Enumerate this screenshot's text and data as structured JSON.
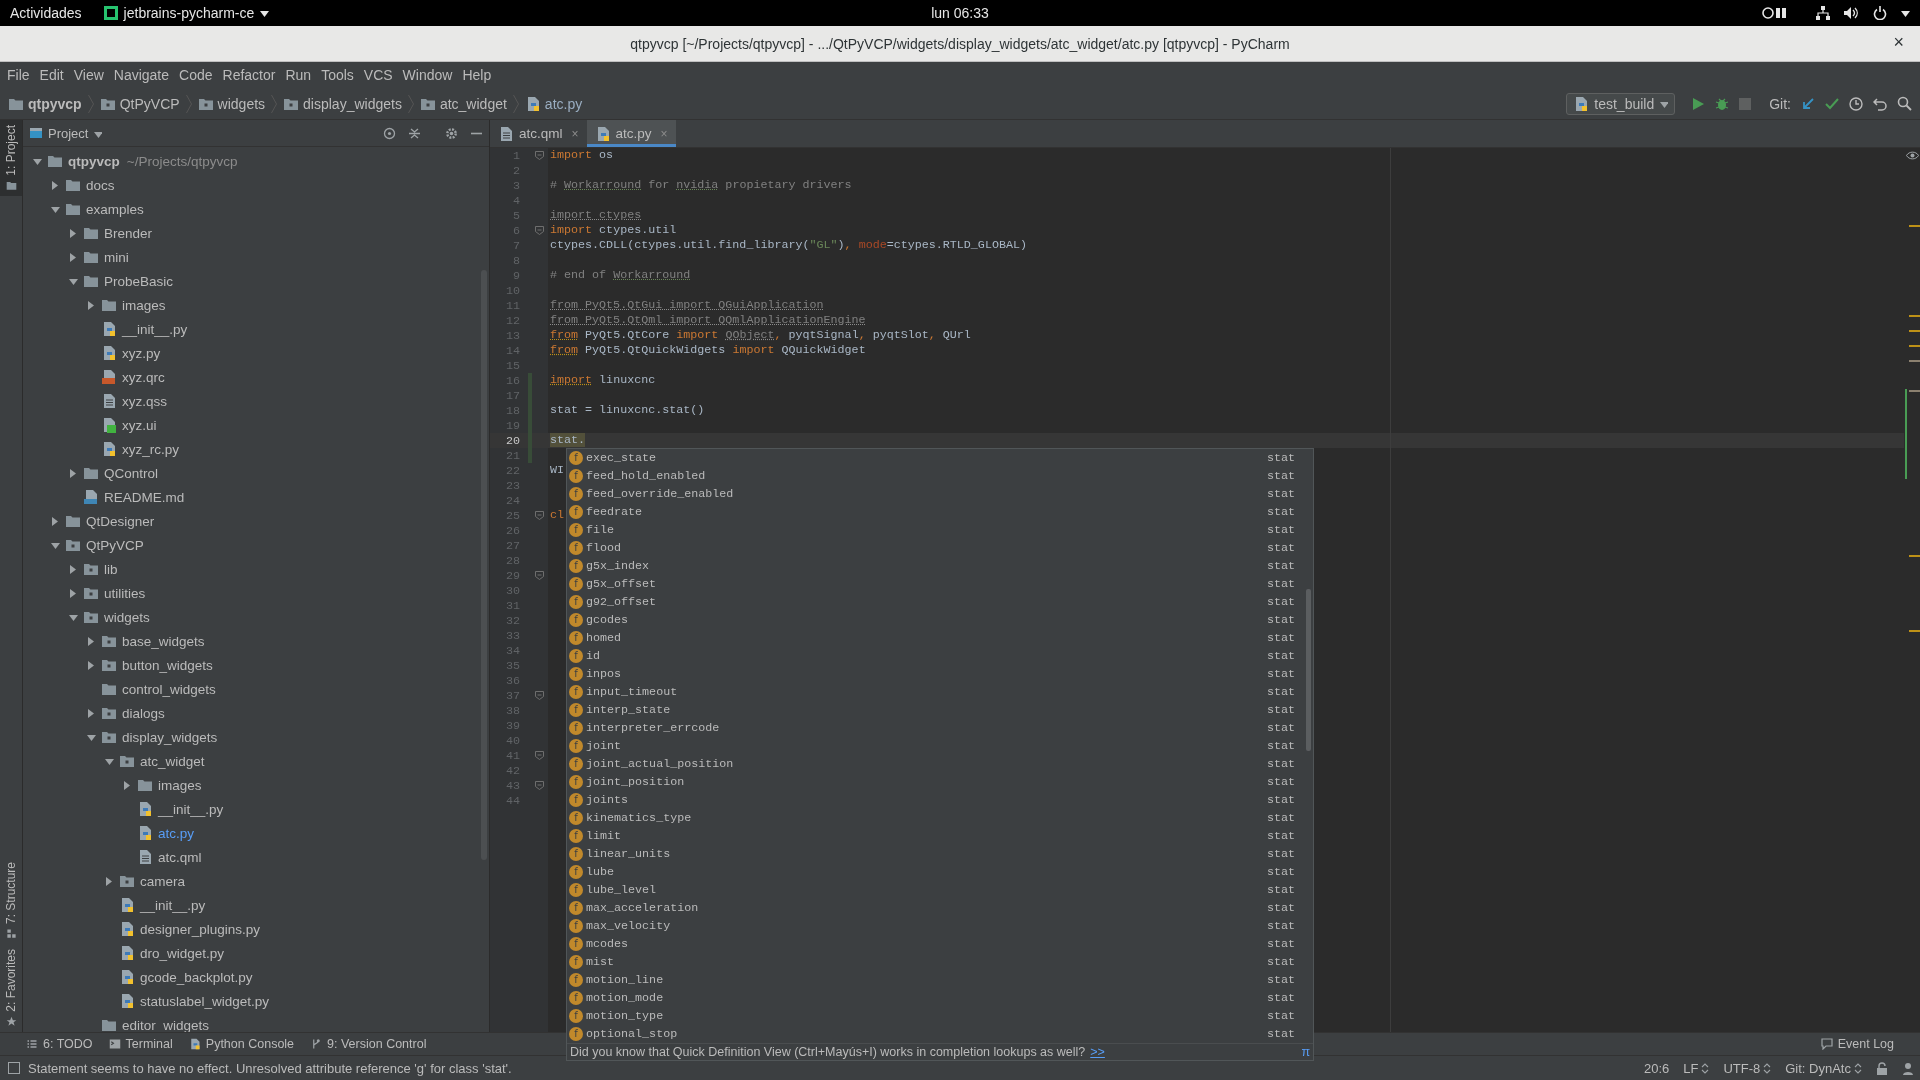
{
  "topbar": {
    "activities": "Actividades",
    "app": "jetbrains-pycharm-ce",
    "clock": "lun 06:33"
  },
  "window": {
    "title": "qtpyvcp [~/Projects/qtpyvcp] - .../QtPyVCP/widgets/display_widgets/atc_widget/atc.py [qtpyvcp] - PyCharm",
    "close": "×"
  },
  "menu": [
    "File",
    "Edit",
    "View",
    "Navigate",
    "Code",
    "Refactor",
    "Run",
    "Tools",
    "VCS",
    "Window",
    "Help"
  ],
  "breadcrumbs": [
    {
      "label": "qtpyvcp",
      "kind": "folder"
    },
    {
      "label": "QtPyVCP",
      "kind": "package"
    },
    {
      "label": "widgets",
      "kind": "package"
    },
    {
      "label": "display_widgets",
      "kind": "package"
    },
    {
      "label": "atc_widget",
      "kind": "package"
    },
    {
      "label": "atc.py",
      "kind": "python"
    }
  ],
  "toolbar": {
    "run_config": "test_build",
    "git_label": "Git:"
  },
  "tool_stripe": [
    {
      "label": "1: Project",
      "kind": "project",
      "selected": true
    },
    {
      "label": "7: Structure",
      "kind": "structure",
      "selected": false
    },
    {
      "label": "2: Favorites",
      "kind": "favorites",
      "selected": false
    }
  ],
  "project": {
    "title": "Project",
    "tree": [
      {
        "label": "qtpyvcp",
        "path": "~/Projects/qtpyvcp",
        "kind": "folder",
        "expanded": true,
        "selected": false,
        "children": [
          {
            "label": "docs",
            "kind": "folder",
            "expanded": false,
            "selected": false
          },
          {
            "label": "examples",
            "kind": "folder",
            "expanded": true,
            "selected": false,
            "children": [
              {
                "label": "Brender",
                "kind": "folder",
                "expanded": false,
                "selected": false
              },
              {
                "label": "mini",
                "kind": "folder",
                "expanded": false,
                "selected": false
              },
              {
                "label": "ProbeBasic",
                "kind": "folder",
                "expanded": true,
                "selected": false,
                "children": [
                  {
                    "label": "images",
                    "kind": "folder",
                    "expanded": false,
                    "selected": false
                  },
                  {
                    "label": "__init__.py",
                    "kind": "python",
                    "selected": false
                  },
                  {
                    "label": "xyz.py",
                    "kind": "python",
                    "selected": false
                  },
                  {
                    "label": "xyz.qrc",
                    "kind": "qrc",
                    "selected": false
                  },
                  {
                    "label": "xyz.qss",
                    "kind": "text",
                    "selected": false
                  },
                  {
                    "label": "xyz.ui",
                    "kind": "ui",
                    "selected": false
                  },
                  {
                    "label": "xyz_rc.py",
                    "kind": "python",
                    "selected": false
                  }
                ]
              },
              {
                "label": "QControl",
                "kind": "folder",
                "expanded": false,
                "selected": false
              },
              {
                "label": "README.md",
                "kind": "md",
                "selected": false
              }
            ]
          },
          {
            "label": "QtDesigner",
            "kind": "folder",
            "expanded": false,
            "selected": false
          },
          {
            "label": "QtPyVCP",
            "kind": "package",
            "expanded": true,
            "selected": false,
            "children": [
              {
                "label": "lib",
                "kind": "package",
                "expanded": false,
                "selected": false
              },
              {
                "label": "utilities",
                "kind": "package",
                "expanded": false,
                "selected": false
              },
              {
                "label": "widgets",
                "kind": "package",
                "expanded": true,
                "selected": false,
                "children": [
                  {
                    "label": "base_widgets",
                    "kind": "package",
                    "expanded": false,
                    "selected": false
                  },
                  {
                    "label": "button_widgets",
                    "kind": "package",
                    "expanded": false,
                    "selected": false
                  },
                  {
                    "label": "control_widgets",
                    "kind": "folder",
                    "selected": false
                  },
                  {
                    "label": "dialogs",
                    "kind": "package",
                    "expanded": false,
                    "selected": false
                  },
                  {
                    "label": "display_widgets",
                    "kind": "package",
                    "expanded": true,
                    "selected": false,
                    "children": [
                      {
                        "label": "atc_widget",
                        "kind": "package",
                        "expanded": true,
                        "selected": false,
                        "children": [
                          {
                            "label": "images",
                            "kind": "folder",
                            "expanded": false,
                            "selected": false
                          },
                          {
                            "label": "__init__.py",
                            "kind": "python",
                            "selected": false
                          },
                          {
                            "label": "atc.py",
                            "kind": "python",
                            "selected": true
                          },
                          {
                            "label": "atc.qml",
                            "kind": "text",
                            "selected": false
                          }
                        ]
                      },
                      {
                        "label": "camera",
                        "kind": "package",
                        "expanded": false,
                        "selected": false
                      },
                      {
                        "label": "__init__.py",
                        "kind": "python",
                        "selected": false
                      },
                      {
                        "label": "designer_plugins.py",
                        "kind": "python",
                        "selected": false
                      },
                      {
                        "label": "dro_widget.py",
                        "kind": "python",
                        "selected": false
                      },
                      {
                        "label": "gcode_backplot.py",
                        "kind": "python",
                        "selected": false
                      },
                      {
                        "label": "statuslabel_widget.py",
                        "kind": "python",
                        "selected": false
                      }
                    ]
                  },
                  {
                    "label": "editor_widgets",
                    "kind": "folder",
                    "selected": false
                  }
                ]
              }
            ]
          }
        ]
      }
    ]
  },
  "tabs": [
    {
      "label": "atc.qml",
      "kind": "text",
      "selected": false,
      "close": "×"
    },
    {
      "label": "atc.py",
      "kind": "python",
      "selected": true,
      "close": "×"
    }
  ],
  "editor": {
    "lines": [
      {
        "number": "1",
        "fold": true,
        "changed": false,
        "current": false,
        "tokens": [
          {
            "kind": "kw",
            "text": "import"
          },
          {
            "kind": "text",
            "text": " os"
          }
        ]
      },
      {
        "number": "2",
        "fold": false,
        "changed": false,
        "current": false
      },
      {
        "number": "3",
        "fold": false,
        "changed": false,
        "current": false,
        "tokens": [
          {
            "kind": "comment",
            "text": "# "
          },
          {
            "kind": "typo",
            "text": "Workarround"
          },
          {
            "kind": "comment",
            "text": " for "
          },
          {
            "kind": "typo",
            "text": "nvidia"
          },
          {
            "kind": "comment",
            "text": " propietary"
          },
          {
            "kind": "comment",
            "text": " drivers"
          }
        ]
      },
      {
        "number": "4",
        "fold": false,
        "changed": false,
        "current": false
      },
      {
        "number": "5",
        "fold": false,
        "changed": false,
        "current": false,
        "tokens": [
          {
            "kind": "unused",
            "text": "import ctypes"
          }
        ]
      },
      {
        "number": "6",
        "fold": true,
        "changed": false,
        "current": false,
        "tokens": [
          {
            "kind": "kw",
            "text": "import"
          },
          {
            "kind": "text",
            "text": " ctypes.util"
          }
        ]
      },
      {
        "number": "7",
        "fold": false,
        "changed": false,
        "current": false,
        "tokens": [
          {
            "kind": "text",
            "text": "ctypes.CDLL(ctypes.util.find_library("
          },
          {
            "kind": "string",
            "text": "\"GL\""
          },
          {
            "kind": "text",
            "text": ")"
          },
          {
            "kind": "kw",
            "text": ", "
          },
          {
            "kind": "param",
            "text": "mode"
          },
          {
            "kind": "text",
            "text": "=ctypes.RTLD_GLOBAL)"
          }
        ]
      },
      {
        "number": "8",
        "fold": false,
        "changed": false,
        "current": false
      },
      {
        "number": "9",
        "fold": false,
        "changed": false,
        "current": false,
        "tokens": [
          {
            "kind": "comment",
            "text": "# end of "
          },
          {
            "kind": "typo",
            "text": "Workarround"
          }
        ]
      },
      {
        "number": "10",
        "fold": false,
        "changed": false,
        "current": false
      },
      {
        "number": "11",
        "fold": false,
        "changed": false,
        "current": false,
        "tokens": [
          {
            "kind": "unused",
            "text": "from PyQt5.QtGui import QGuiApplication"
          }
        ]
      },
      {
        "number": "12",
        "fold": false,
        "changed": false,
        "current": false,
        "tokens": [
          {
            "kind": "unused",
            "text": "from PyQt5.QtQml import QQmlApplicationEngine"
          }
        ]
      },
      {
        "number": "13",
        "fold": false,
        "changed": false,
        "current": false,
        "tokens": [
          {
            "kind": "kwwarn",
            "text": "from"
          },
          {
            "kind": "text",
            "text": " PyQt5.QtCore "
          },
          {
            "kind": "kw",
            "text": "import "
          },
          {
            "kind": "unused",
            "text": "QObject"
          },
          {
            "kind": "kw",
            "text": ", "
          },
          {
            "kind": "text",
            "text": "pyqtSignal"
          },
          {
            "kind": "kw",
            "text": ", "
          },
          {
            "kind": "text",
            "text": "pyqtSlot"
          },
          {
            "kind": "kw",
            "text": ", "
          },
          {
            "kind": "text",
            "text": "QUrl"
          }
        ]
      },
      {
        "number": "14",
        "fold": false,
        "changed": false,
        "current": false,
        "tokens": [
          {
            "kind": "kwwarn",
            "text": "from"
          },
          {
            "kind": "text",
            "text": " PyQt5.QtQuickWidgets "
          },
          {
            "kind": "kw",
            "text": "import"
          },
          {
            "kind": "text",
            "text": " QQuickWidget"
          }
        ]
      },
      {
        "number": "15",
        "fold": false,
        "changed": false,
        "current": false
      },
      {
        "number": "16",
        "fold": false,
        "changed": true,
        "current": false,
        "tokens": [
          {
            "kind": "kwwarn",
            "text": "import"
          },
          {
            "kind": "text",
            "text": " linuxcnc"
          }
        ]
      },
      {
        "number": "17",
        "fold": false,
        "changed": true,
        "current": false
      },
      {
        "number": "18",
        "fold": false,
        "changed": true,
        "current": false,
        "tokens": [
          {
            "kind": "text",
            "text": "stat = linuxcnc.stat()"
          }
        ]
      },
      {
        "number": "19",
        "fold": false,
        "changed": true,
        "current": false
      },
      {
        "number": "20",
        "fold": false,
        "changed": true,
        "current": true,
        "tokens": [
          {
            "kind": "warn",
            "text": "stat."
          }
        ]
      },
      {
        "number": "21",
        "fold": false,
        "changed": true,
        "current": false
      },
      {
        "number": "22",
        "fold": false,
        "changed": false,
        "current": false,
        "tokens": [
          {
            "kind": "text",
            "text": "WI"
          }
        ]
      },
      {
        "number": "23",
        "fold": false,
        "changed": false,
        "current": false
      },
      {
        "number": "24",
        "fold": false,
        "changed": false,
        "current": false
      },
      {
        "number": "25",
        "fold": true,
        "changed": false,
        "current": false,
        "tokens": [
          {
            "kind": "kw",
            "text": "cl"
          }
        ]
      },
      {
        "number": "26",
        "fold": false,
        "changed": false,
        "current": false
      },
      {
        "number": "27",
        "fold": false,
        "changed": false,
        "current": false
      },
      {
        "number": "28",
        "fold": false,
        "changed": false,
        "current": false
      },
      {
        "number": "29",
        "fold": true,
        "changed": false,
        "current": false
      },
      {
        "number": "30",
        "fold": false,
        "changed": false,
        "current": false
      },
      {
        "number": "31",
        "fold": false,
        "changed": false,
        "current": false
      },
      {
        "number": "32",
        "fold": false,
        "changed": false,
        "current": false
      },
      {
        "number": "33",
        "fold": false,
        "changed": false,
        "current": false
      },
      {
        "number": "34",
        "fold": false,
        "changed": false,
        "current": false
      },
      {
        "number": "35",
        "fold": false,
        "changed": false,
        "current": false
      },
      {
        "number": "36",
        "fold": false,
        "changed": false,
        "current": false
      },
      {
        "number": "37",
        "fold": true,
        "changed": false,
        "current": false
      },
      {
        "number": "38",
        "fold": false,
        "changed": false,
        "current": false
      },
      {
        "number": "39",
        "fold": false,
        "changed": false,
        "current": false
      },
      {
        "number": "40",
        "fold": false,
        "changed": false,
        "current": false
      },
      {
        "number": "41",
        "fold": true,
        "changed": false,
        "current": false
      },
      {
        "number": "42",
        "fold": false,
        "changed": false,
        "current": false
      },
      {
        "number": "43",
        "fold": true,
        "changed": false,
        "current": false
      },
      {
        "number": "44",
        "fold": false,
        "changed": false,
        "current": false
      }
    ]
  },
  "completion": {
    "items": [
      {
        "badge": "f",
        "name": "exec_state",
        "type": "stat"
      },
      {
        "badge": "f",
        "name": "feed_hold_enabled",
        "type": "stat"
      },
      {
        "badge": "f",
        "name": "feed_override_enabled",
        "type": "stat"
      },
      {
        "badge": "f",
        "name": "feedrate",
        "type": "stat"
      },
      {
        "badge": "f",
        "name": "file",
        "type": "stat"
      },
      {
        "badge": "f",
        "name": "flood",
        "type": "stat"
      },
      {
        "badge": "f",
        "name": "g5x_index",
        "type": "stat"
      },
      {
        "badge": "f",
        "name": "g5x_offset",
        "type": "stat"
      },
      {
        "badge": "f",
        "name": "g92_offset",
        "type": "stat"
      },
      {
        "badge": "f",
        "name": "gcodes",
        "type": "stat"
      },
      {
        "badge": "f",
        "name": "homed",
        "type": "stat"
      },
      {
        "badge": "f",
        "name": "id",
        "type": "stat"
      },
      {
        "badge": "f",
        "name": "inpos",
        "type": "stat"
      },
      {
        "badge": "f",
        "name": "input_timeout",
        "type": "stat"
      },
      {
        "badge": "f",
        "name": "interp_state",
        "type": "stat"
      },
      {
        "badge": "f",
        "name": "interpreter_errcode",
        "type": "stat"
      },
      {
        "badge": "f",
        "name": "joint",
        "type": "stat"
      },
      {
        "badge": "f",
        "name": "joint_actual_position",
        "type": "stat"
      },
      {
        "badge": "f",
        "name": "joint_position",
        "type": "stat"
      },
      {
        "badge": "f",
        "name": "joints",
        "type": "stat"
      },
      {
        "badge": "f",
        "name": "kinematics_type",
        "type": "stat"
      },
      {
        "badge": "f",
        "name": "limit",
        "type": "stat"
      },
      {
        "badge": "f",
        "name": "linear_units",
        "type": "stat"
      },
      {
        "badge": "f",
        "name": "lube",
        "type": "stat"
      },
      {
        "badge": "f",
        "name": "lube_level",
        "type": "stat"
      },
      {
        "badge": "f",
        "name": "max_acceleration",
        "type": "stat"
      },
      {
        "badge": "f",
        "name": "max_velocity",
        "type": "stat"
      },
      {
        "badge": "f",
        "name": "mcodes",
        "type": "stat"
      },
      {
        "badge": "f",
        "name": "mist",
        "type": "stat"
      },
      {
        "badge": "f",
        "name": "motion_line",
        "type": "stat"
      },
      {
        "badge": "f",
        "name": "motion_mode",
        "type": "stat"
      },
      {
        "badge": "f",
        "name": "motion_type",
        "type": "stat"
      },
      {
        "badge": "f",
        "name": "optional_stop",
        "type": "stat"
      }
    ],
    "hint": "Did you know that Quick Definition View (Ctrl+Mayús+I) works in completion lookups as well?",
    "hint_link": ">>",
    "pin": "π"
  },
  "tool_windows": [
    {
      "label": "6: TODO",
      "kind": "todo"
    },
    {
      "label": "Terminal",
      "kind": "terminal"
    },
    {
      "label": "Python Console",
      "kind": "python"
    },
    {
      "label": "9: Version Control",
      "kind": "vcs"
    }
  ],
  "event_log": "Event Log",
  "status": {
    "message": "Statement seems to have no effect. Unresolved attribute reference 'g' for class 'stat'.",
    "position": "20:6",
    "line_sep": "LF",
    "encoding": "UTF-8",
    "vcs": "Git: DynAtc"
  }
}
